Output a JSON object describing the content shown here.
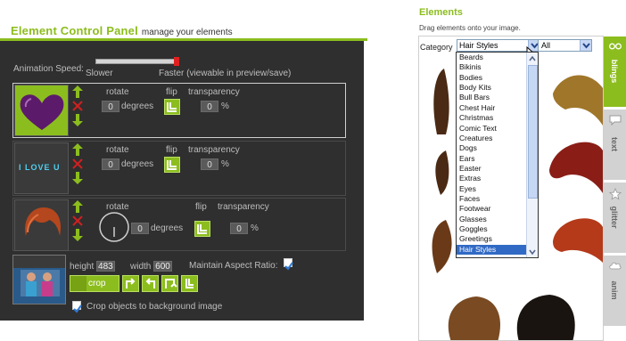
{
  "left_panel": {
    "title": "Element Control Panel",
    "subtitle": "manage your elements",
    "animation": {
      "label": "Animation Speed:",
      "slower": "Slower",
      "faster": "Faster (viewable in preview/save)",
      "level": 1.0
    },
    "labels": {
      "rotate": "rotate",
      "flip": "flip",
      "transparency": "transparency",
      "degrees": "degrees",
      "percent": "%"
    },
    "elements": [
      {
        "name": "heart",
        "rotate": "0",
        "transparency": "0"
      },
      {
        "name": "I LOVE U",
        "rotate": "0",
        "transparency": "0"
      },
      {
        "name": "hair",
        "rotate": "0",
        "transparency": "0"
      }
    ],
    "background": {
      "height_label": "height",
      "height": "483",
      "width_label": "width",
      "width": "600",
      "aspect_label": "Maintain Aspect Ratio:",
      "crop_label": "crop",
      "crop_objects_label": "Crop objects to background image"
    }
  },
  "right_panel": {
    "title": "Elements",
    "subtitle": "Drag elements onto your image.",
    "category_label": "Category",
    "category_value": "Hair Styles",
    "filter_value": "All",
    "options": [
      "Beards",
      "Bikinis",
      "Bodies",
      "Body Kits",
      "Bull Bars",
      "Chest Hair",
      "Christmas",
      "Comic Text",
      "Creatures",
      "Dogs",
      "Ears",
      "Easter",
      "Extras",
      "Eyes",
      "Faces",
      "Footwear",
      "Glasses",
      "Goggles",
      "Greetings",
      "Hair Styles"
    ],
    "selected_option": "Hair Styles",
    "tabs": [
      {
        "label": "blings",
        "icon": "glasses-icon",
        "active": true
      },
      {
        "label": "text",
        "icon": "speech-bubble-icon",
        "active": false
      },
      {
        "label": "glitter",
        "icon": "star-icon",
        "active": false
      },
      {
        "label": "anim",
        "icon": "cloud-icon",
        "active": false
      }
    ]
  }
}
